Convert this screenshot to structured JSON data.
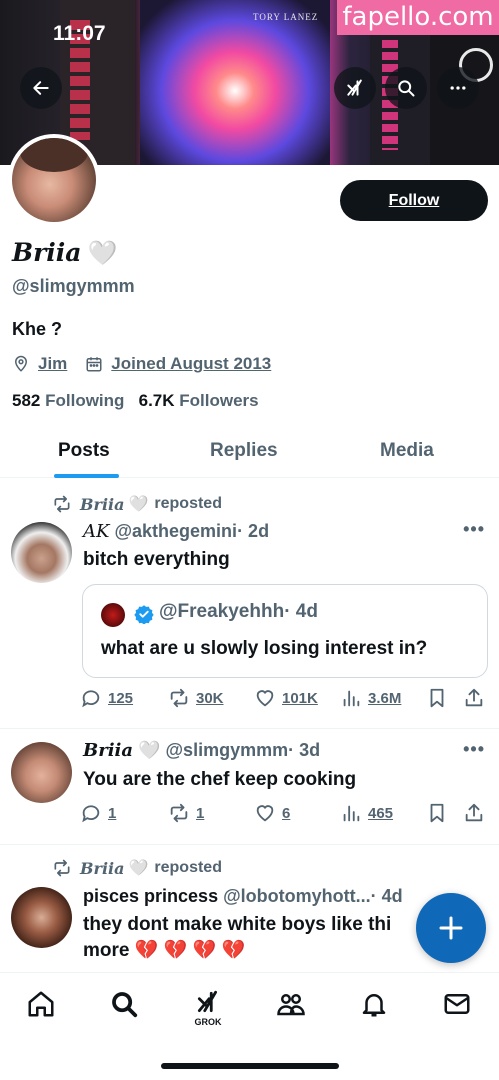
{
  "status_bar": {
    "time": "11:07"
  },
  "watermark": "fapello.com",
  "banner": {
    "poster_text": "TORY LANEZ"
  },
  "header_buttons": [
    {
      "name": "back-button",
      "icon": "arrow-left-icon"
    },
    {
      "name": "grok-button",
      "icon": "grok-icon"
    },
    {
      "name": "search-button",
      "icon": "search-icon"
    },
    {
      "name": "more-button",
      "icon": "ellipsis-icon"
    }
  ],
  "profile": {
    "display_name": "Briia",
    "heart": "🤍",
    "handle": "@slimgymmm",
    "bio": "Khe ?",
    "location": "Jim",
    "joined": "Joined August 2013",
    "following_count": "582",
    "following_label": "Following",
    "followers_count": "6.7K",
    "followers_label": "Followers",
    "follow_button": "Follow"
  },
  "tabs": [
    {
      "label": "Posts",
      "active": true
    },
    {
      "label": "Replies",
      "active": false
    },
    {
      "label": "Media",
      "active": false
    }
  ],
  "posts": [
    {
      "repost_by": "Briia",
      "repost_heart": "🤍",
      "repost_suffix": "reposted",
      "author_name": "AK",
      "author_handle": "@akthegemini",
      "time": "· 2d",
      "text": "bitch everything",
      "quote": {
        "handle": "@Freakyehhh",
        "time": "· 4d",
        "text": "what are u slowly losing interest in?"
      },
      "stats": {
        "replies": "125",
        "reposts": "30K",
        "likes": "101K",
        "views": "3.6M"
      }
    },
    {
      "author_name": "Briia",
      "author_heart": "🤍",
      "author_handle": "@slimgymmm",
      "time": "· 3d",
      "text": "You are the chef keep cooking",
      "stats": {
        "replies": "1",
        "reposts": "1",
        "likes": "6",
        "views": "465"
      }
    },
    {
      "repost_by": "Briia",
      "repost_heart": "🤍",
      "repost_suffix": "reposted",
      "author_name": "pisces princess",
      "author_handle": "@lobotomyhott...",
      "time": "· 4d",
      "text_line1": "they dont make white boys like thi",
      "text_line2": "more 💔 💔 💔 💔"
    }
  ],
  "bottom_nav": {
    "items": [
      "home-icon",
      "search-icon",
      "grok-icon",
      "communities-icon",
      "notifications-icon",
      "messages-icon"
    ],
    "grok_label": "GROK"
  },
  "colors": {
    "accent": "#1d9bf0",
    "fab": "#1068b8",
    "text": "#0f1419",
    "muted": "#536471"
  }
}
